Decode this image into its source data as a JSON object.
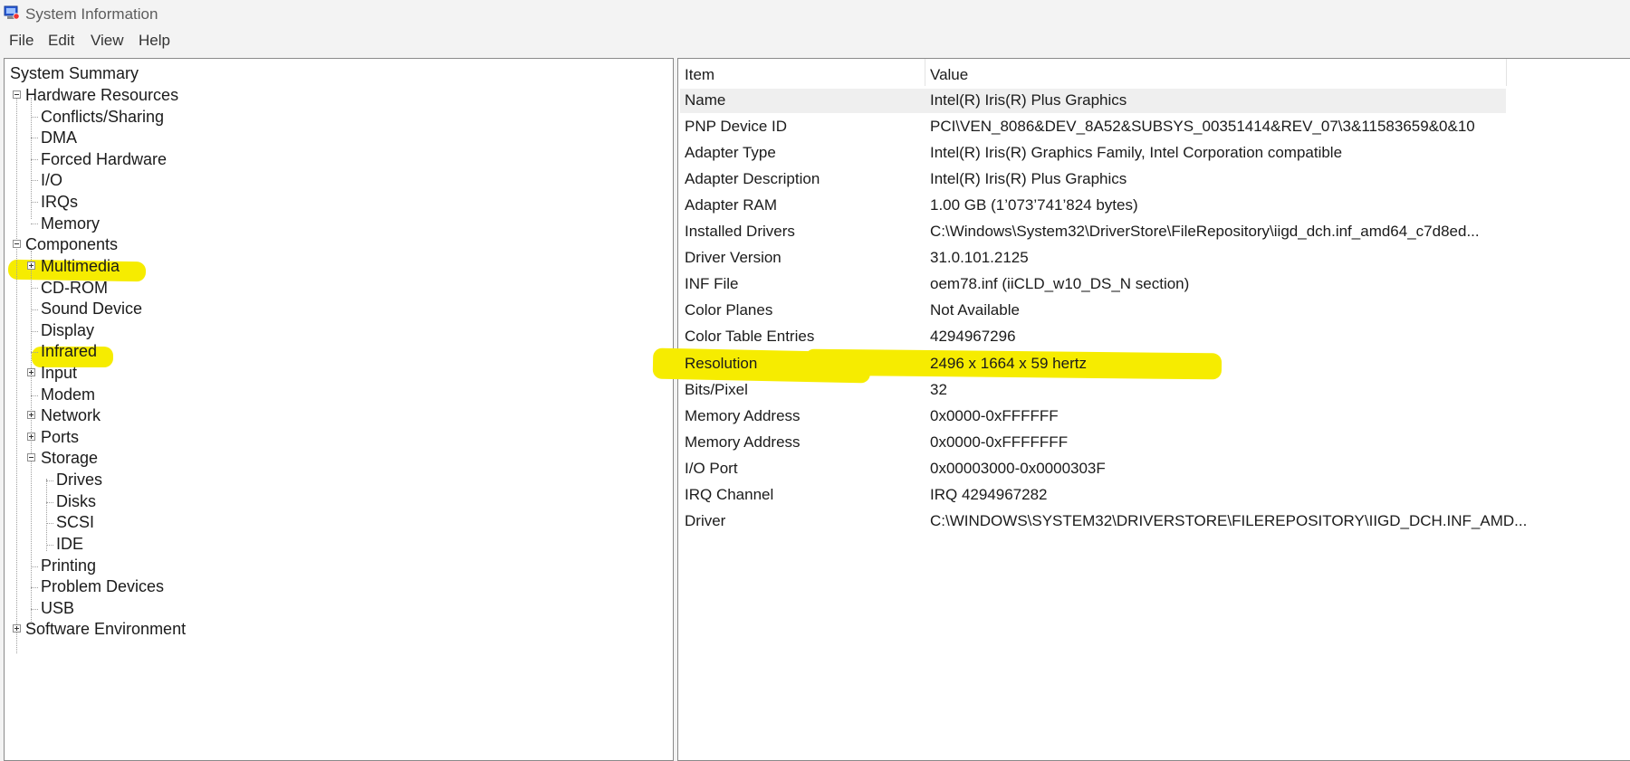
{
  "window": {
    "title": "System Information"
  },
  "menu": [
    "File",
    "Edit",
    "View",
    "Help"
  ],
  "tree": {
    "system_summary": "System Summary",
    "hardware_resources": "Hardware Resources",
    "hardware_children": [
      "Conflicts/Sharing",
      "DMA",
      "Forced Hardware",
      "I/O",
      "IRQs",
      "Memory"
    ],
    "components": "Components",
    "components_children": [
      "Multimedia",
      "CD-ROM",
      "Sound Device",
      "Display",
      "Infrared",
      "Input",
      "Modem",
      "Network",
      "Ports",
      "Storage"
    ],
    "storage_children": [
      "Drives",
      "Disks",
      "SCSI",
      "IDE"
    ],
    "components_tail": [
      "Printing",
      "Problem Devices",
      "USB"
    ],
    "software_environment": "Software Environment",
    "selected": "Display"
  },
  "table": {
    "columns": [
      "Item",
      "Value"
    ],
    "rows": [
      [
        "Name",
        "Intel(R) Iris(R) Plus Graphics"
      ],
      [
        "PNP Device ID",
        "PCI\\VEN_8086&DEV_8A52&SUBSYS_00351414&REV_07\\3&11583659&0&10"
      ],
      [
        "Adapter Type",
        "Intel(R) Iris(R) Graphics Family, Intel Corporation compatible"
      ],
      [
        "Adapter Description",
        "Intel(R) Iris(R) Plus Graphics"
      ],
      [
        "Adapter RAM",
        "1.00 GB (1’073’741’824 bytes)"
      ],
      [
        "Installed Drivers",
        "C:\\Windows\\System32\\DriverStore\\FileRepository\\iigd_dch.inf_amd64_c7d8ed..."
      ],
      [
        "Driver Version",
        "31.0.101.2125"
      ],
      [
        "INF File",
        "oem78.inf (iiCLD_w10_DS_N section)"
      ],
      [
        "Color Planes",
        "Not Available"
      ],
      [
        "Color Table Entries",
        "4294967296"
      ],
      [
        "Resolution",
        "2496 x 1664 x 59 hertz"
      ],
      [
        "Bits/Pixel",
        "32"
      ],
      [
        "Memory Address",
        "0x0000-0xFFFFFF"
      ],
      [
        "Memory Address",
        "0x0000-0xFFFFFFF"
      ],
      [
        "I/O Port",
        "0x00003000-0x0000303F"
      ],
      [
        "IRQ Channel",
        "IRQ 4294967282"
      ],
      [
        "Driver",
        "C:\\WINDOWS\\SYSTEM32\\DRIVERSTORE\\FILEREPOSITORY\\IIGD_DCH.INF_AMD..."
      ]
    ]
  },
  "colors": {
    "highlight": "#f6ec00",
    "selected_row": "#efefef"
  },
  "icons": {
    "app": "system-information-icon"
  }
}
